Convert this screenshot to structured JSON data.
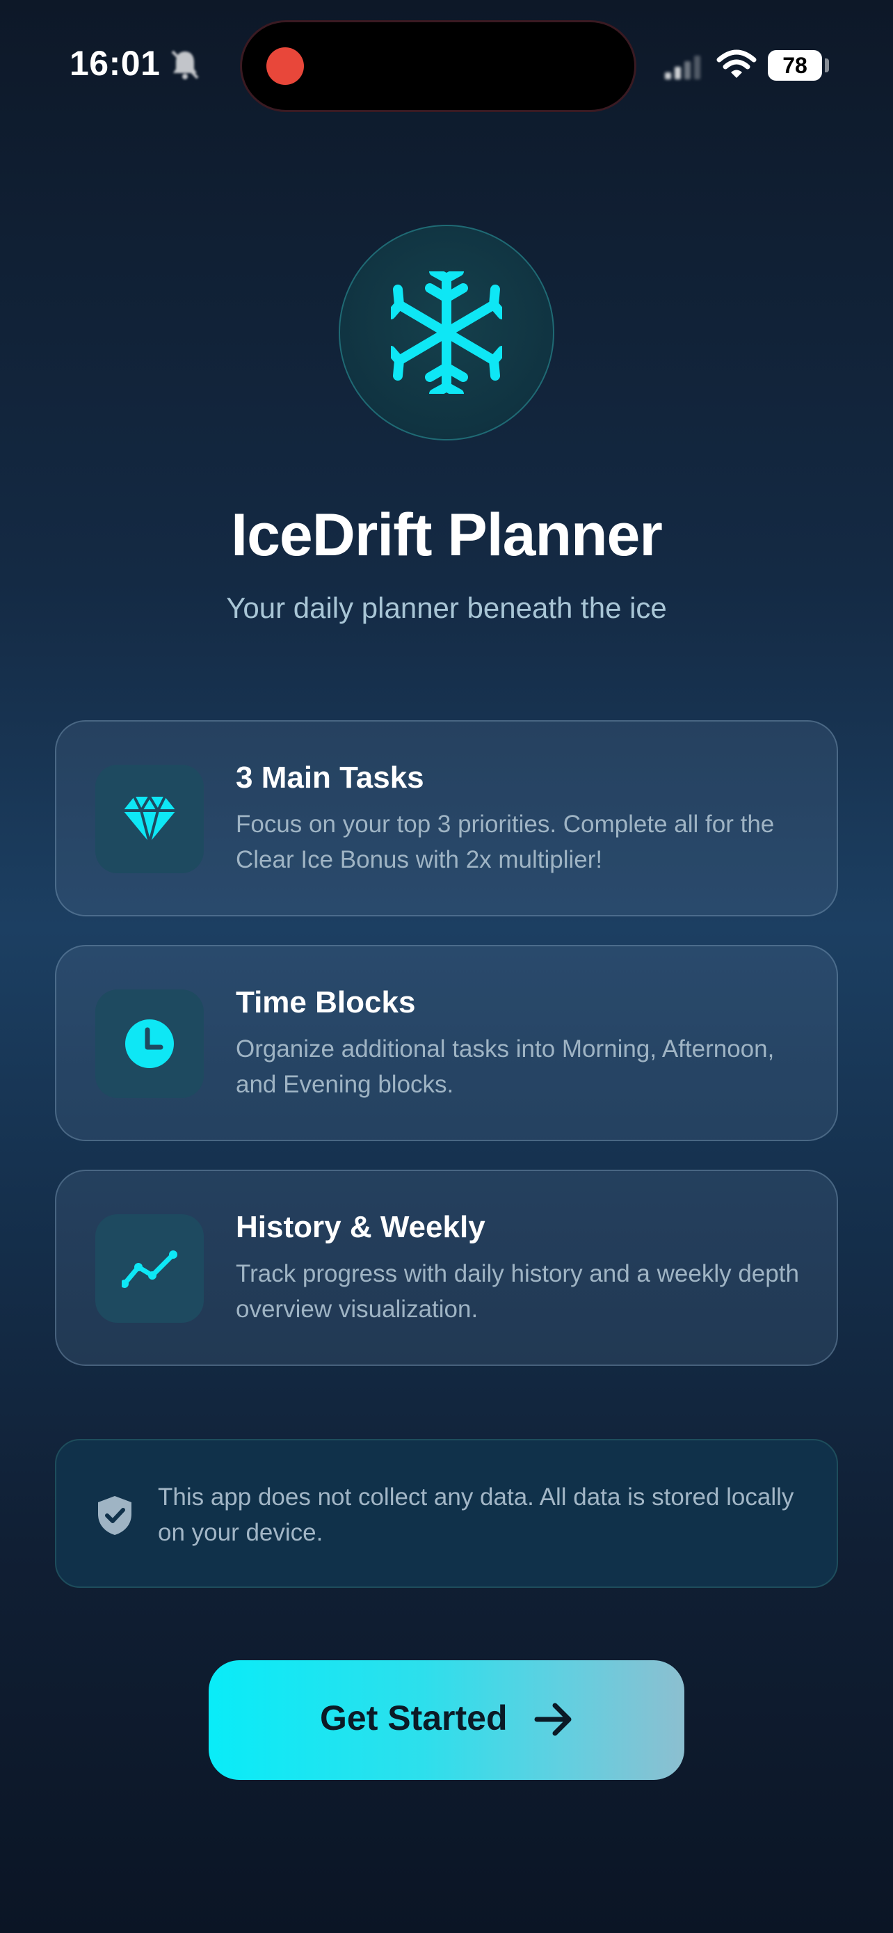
{
  "status_bar": {
    "time": "16:01",
    "battery": "78"
  },
  "hero": {
    "icon": "snowflake-icon",
    "title": "IceDrift Planner",
    "subtitle": "Your daily planner beneath the ice"
  },
  "features": [
    {
      "icon": "diamond-icon",
      "title": "3 Main Tasks",
      "description": "Focus on your top 3 priorities. Complete all for the Clear Ice Bonus with 2x multiplier!"
    },
    {
      "icon": "clock-icon",
      "title": "Time Blocks",
      "description": "Organize additional tasks into Morning, Afternoon, and Evening blocks."
    },
    {
      "icon": "trend-line-icon",
      "title": "History & Weekly",
      "description": "Track progress with daily history and a weekly depth overview visualization."
    }
  ],
  "privacy": {
    "icon": "shield-check-icon",
    "text": "This app does not collect any data. All data is stored locally on your device."
  },
  "cta": {
    "label": "Get Started",
    "icon": "arrow-right-icon"
  },
  "colors": {
    "accent": "#0ee7f5",
    "background": "#12263d",
    "card_text": "#9fb4c4"
  }
}
